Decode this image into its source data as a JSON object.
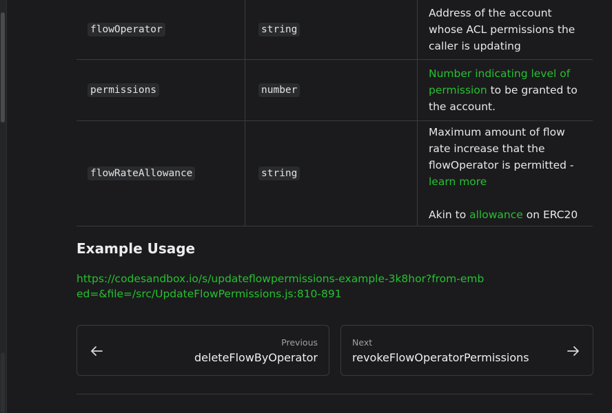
{
  "params_table": {
    "rows": [
      {
        "name": "flowOperator",
        "type": "string",
        "desc_text": "Address of the account whose ACL permissions the caller is updating"
      },
      {
        "name": "permissions",
        "type": "number",
        "desc_link": "Number indicating level of permission",
        "desc_text": " to be granted to the account."
      },
      {
        "name": "flowRateAllowance",
        "type": "string",
        "desc_text": "Maximum amount of flow rate increase that the flowOperator is permitted - ",
        "desc_link": "learn more",
        "desc2_prefix": "Akin to ",
        "desc2_link": "allowance",
        "desc2_suffix": " on ERC20"
      }
    ]
  },
  "example": {
    "heading": "Example Usage",
    "link": "https://codesandbox.io/s/updateflowpermissions-example-3k8hor?from-embed=&file=/src/UpdateFlowPermissions.js:810-891"
  },
  "pagination": {
    "prev_sub": "Previous",
    "prev_title": "deleteFlowByOperator",
    "next_sub": "Next",
    "next_title": "revokeFlowOperatorPermissions"
  },
  "colors": {
    "background": "#1b1b1d",
    "link": "#25c130",
    "border": "#3a3b3e"
  }
}
